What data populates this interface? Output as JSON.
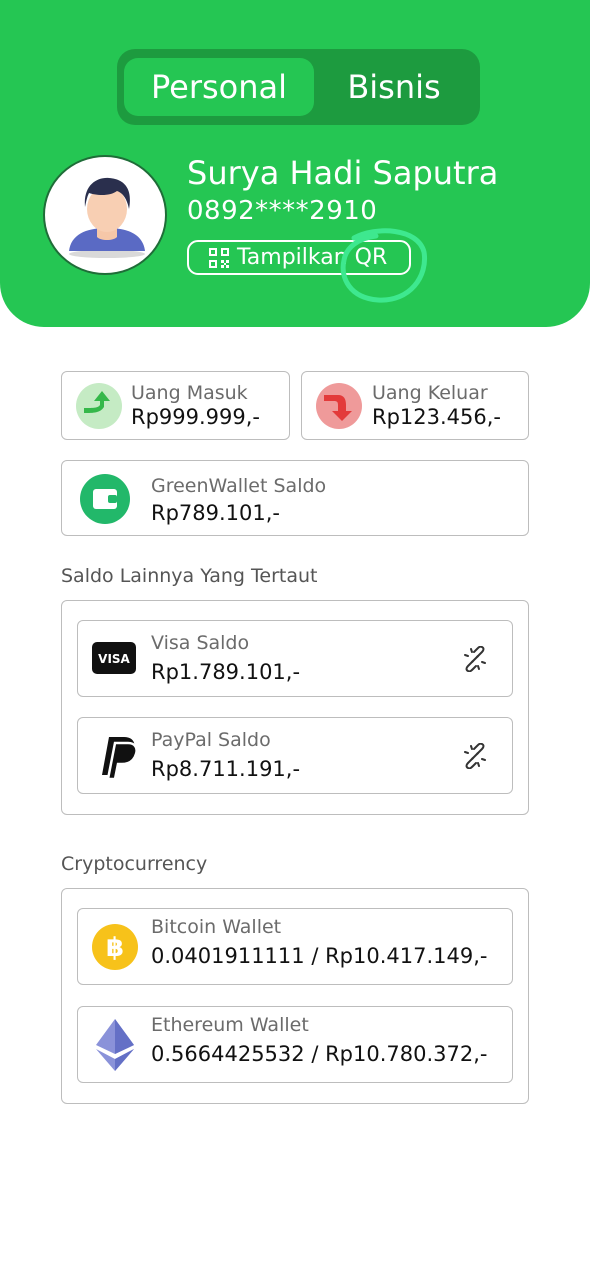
{
  "header": {
    "tabs": {
      "personal": "Personal",
      "bisnis": "Bisnis"
    },
    "user": {
      "name": "Surya Hadi Saputra",
      "phone": "0892****2910"
    },
    "qr_button_label": "Tampilkan QR"
  },
  "summary": {
    "income": {
      "label": "Uang Masuk",
      "value": "Rp999.999,-"
    },
    "expense": {
      "label": "Uang Keluar",
      "value": "Rp123.456,-"
    }
  },
  "wallet": {
    "label": "GreenWallet Saldo",
    "value": "Rp789.101,-"
  },
  "linked": {
    "title": "Saldo Lainnya Yang Tertaut",
    "items": [
      {
        "label": "Visa Saldo",
        "value": "Rp1.789.101,-",
        "icon": "visa-icon",
        "icon_text": "VISA"
      },
      {
        "label": "PayPal Saldo",
        "value": "Rp8.711.191,-",
        "icon": "paypal-icon"
      }
    ]
  },
  "crypto": {
    "title": "Cryptocurrency",
    "items": [
      {
        "label": "Bitcoin Wallet",
        "value": "0.0401911111 / Rp10.417.149,-",
        "icon": "bitcoin-icon"
      },
      {
        "label": "Ethereum Wallet",
        "value": "0.5664425532 / Rp10.780.372,-",
        "icon": "ethereum-icon"
      }
    ]
  },
  "colors": {
    "brand_green": "#25c653",
    "toggle_dark": "#1d9b3f",
    "income_green": "#35b84a",
    "expense_red": "#e33a3a",
    "bitcoin_yellow": "#f7c21a",
    "annotation_green": "#3ee88f"
  }
}
